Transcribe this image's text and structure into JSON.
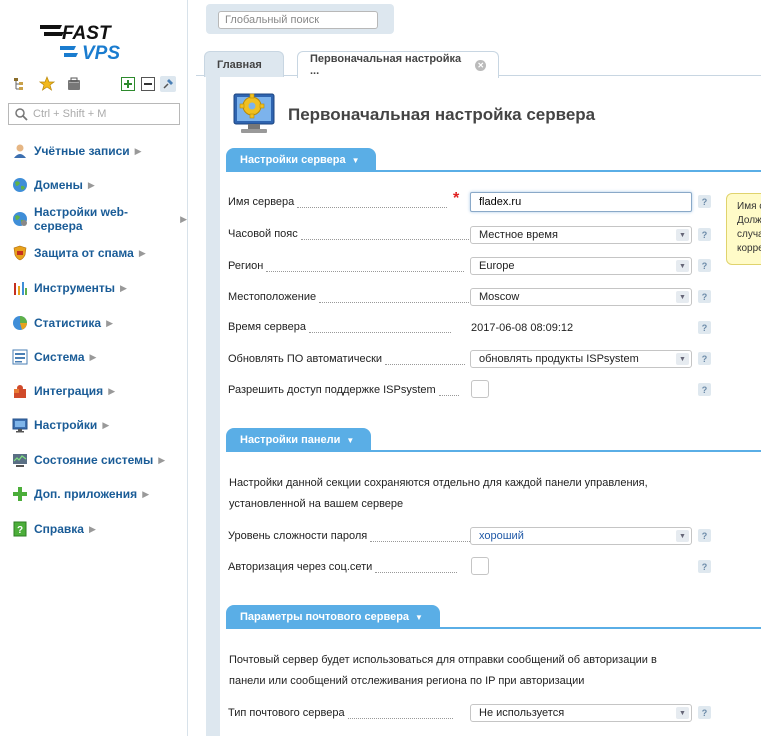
{
  "brand": {
    "line1": "FAST",
    "line2": "VPS"
  },
  "sidebar": {
    "search_placeholder": "Ctrl + Shift + M",
    "items": [
      {
        "label": "Учётные записи",
        "icon": "user-icon"
      },
      {
        "label": "Домены",
        "icon": "globe-icon"
      },
      {
        "label": "Настройки web-сервера",
        "icon": "web-globe-icon"
      },
      {
        "label": "Защита от спама",
        "icon": "shield-icon"
      },
      {
        "label": "Инструменты",
        "icon": "tools-icon"
      },
      {
        "label": "Статистика",
        "icon": "pie-chart-icon"
      },
      {
        "label": "Система",
        "icon": "system-list-icon"
      },
      {
        "label": "Интеграция",
        "icon": "puzzle-icon"
      },
      {
        "label": "Настройки",
        "icon": "monitor-icon"
      },
      {
        "label": "Состояние системы",
        "icon": "status-monitor-icon"
      },
      {
        "label": "Доп. приложения",
        "icon": "plus-icon"
      },
      {
        "label": "Справка",
        "icon": "help-book-icon"
      }
    ]
  },
  "top": {
    "global_search_placeholder": "Глобальный поиск"
  },
  "tabs": [
    {
      "label": "Главная"
    },
    {
      "label": "Первоначальная настройка ..."
    }
  ],
  "page": {
    "title": "Первоначальная настройка сервера"
  },
  "section_server": {
    "title": "Настройки сервера",
    "fields": {
      "server_name": {
        "label": "Имя сервера",
        "value": "fladex.ru"
      },
      "timezone": {
        "label": "Часовой пояс",
        "value": "Местное время"
      },
      "region": {
        "label": "Регион",
        "value": "Europe"
      },
      "location": {
        "label": "Местоположение",
        "value": "Moscow"
      },
      "server_time": {
        "label": "Время сервера",
        "value": "2017-06-08 08:09:12"
      },
      "auto_update": {
        "label": "Обновлять ПО автоматически",
        "value": "обновлять продукты ISPsystem"
      },
      "support_access": {
        "label": "Разрешить доступ поддержке ISPsystem"
      }
    },
    "tooltip": [
      "Имя с",
      "Долж",
      "случа",
      "корре"
    ]
  },
  "section_panel": {
    "title": "Настройки панели",
    "desc_line1": "Настройки данной секции сохраняются отдельно для каждой панели управления,",
    "desc_line2": "установленной на вашем сервере",
    "fields": {
      "password_level": {
        "label": "Уровень сложности пароля",
        "value": "хороший"
      },
      "social_auth": {
        "label": "Авторизация через соц.сети"
      }
    }
  },
  "section_mail": {
    "title": "Параметры почтового сервера",
    "desc_line1": "Почтовый сервер будет использоваться для отправки сообщений об авторизации в",
    "desc_line2": "панели или сообщений отслеживания региона по IP при авторизации",
    "fields": {
      "mail_type": {
        "label": "Тип почтового сервера",
        "value": "Не используется"
      }
    }
  },
  "help_glyph": "?",
  "required_glyph": "*",
  "colors": {
    "section_blue": "#5aaee6",
    "link_blue": "#1a5c97",
    "required_red": "#e02020"
  }
}
